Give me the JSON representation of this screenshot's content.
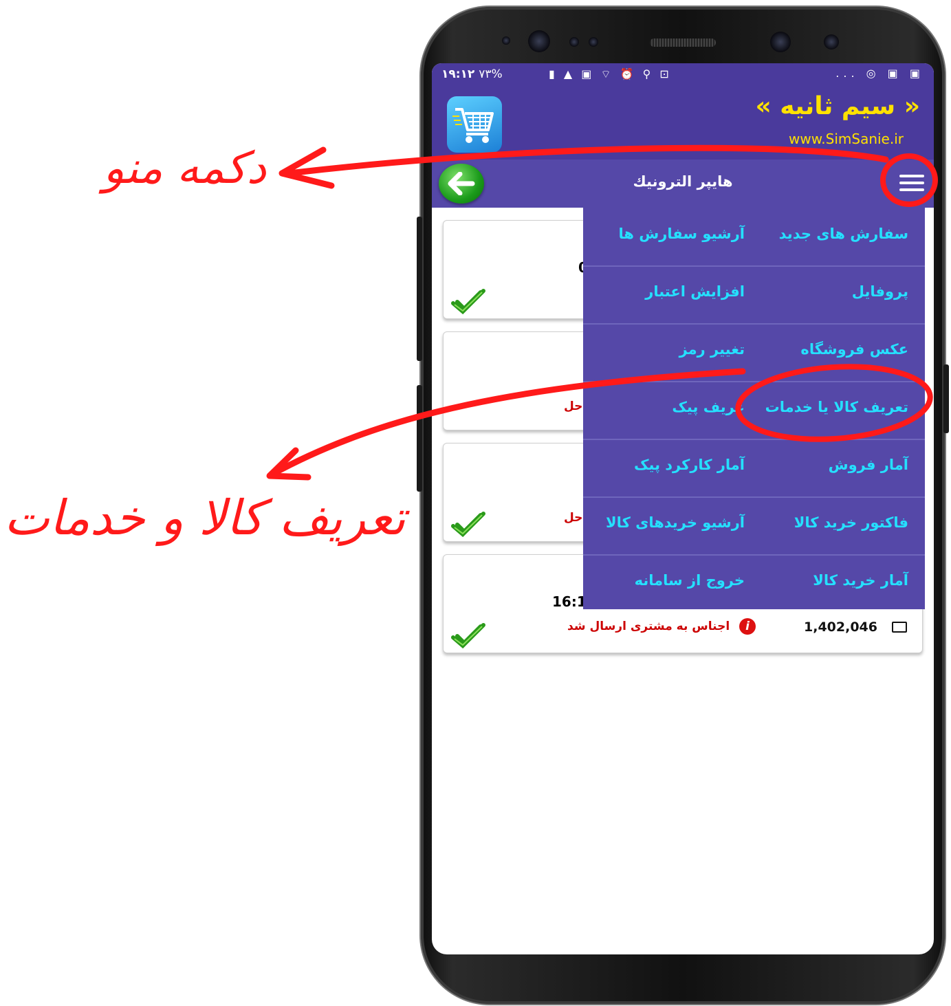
{
  "status_bar": {
    "time": "۱۹:۱۲",
    "battery": "۷۳%",
    "icons_left": "▮ ▲ ▣ ⌔ ⏰ ⚲ ⊡",
    "icons_right": "... ◎ ▣ ▣"
  },
  "brand": {
    "title": "« سیم ثانیه »",
    "url": "www.SimSanie.ir"
  },
  "topbar": {
    "title": "هايپر الترونيك"
  },
  "cards": [
    {
      "fragment": "0",
      "time": "",
      "status": "",
      "amount": ""
    },
    {
      "fragment": "حل",
      "time": "",
      "status": "",
      "amount": ""
    },
    {
      "fragment": "حل",
      "time": "",
      "status": "",
      "amount": ""
    },
    {
      "fragment": "",
      "time": "16:1",
      "status": "اجناس به مشتری ارسال شد",
      "amount": "1,402,046"
    }
  ],
  "menu": {
    "rows": [
      {
        "right": "سفارش های جدید",
        "left": "آرشیو سفارش ها"
      },
      {
        "right": "پروفایل",
        "left": "افزایش اعتبار"
      },
      {
        "right": "عکس فروشگاه",
        "left": "تغییر رمز"
      },
      {
        "right": "تعریف کالا یا خدمات",
        "left": "عریف پیک"
      },
      {
        "right": "آمار فروش",
        "left": "آمار کارکرد پیک"
      },
      {
        "right": "فاکتور خرید کالا",
        "left": "آرشیو خریدهای کالا"
      },
      {
        "right": "آمار خرید کالا",
        "left": "خروج از سامانه"
      }
    ]
  },
  "annotations": {
    "menu_button_label": "دکمه منو",
    "define_goods_label": "تعریف کالا و خدمات",
    "color": "#ff1a1a"
  },
  "icons": {
    "back": "arrow-left-icon",
    "menu": "hamburger-icon",
    "check": "check-icon",
    "info": "info-icon",
    "money": "money-icon",
    "logo": "shopping-cart-icon"
  }
}
